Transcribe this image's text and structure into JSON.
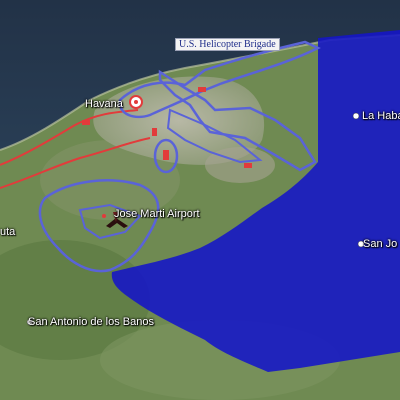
{
  "banner": {
    "text": "U.S. Helicopter Brigade"
  },
  "places": {
    "havana": "Havana",
    "la_habana": "La Haba",
    "jose_marti": "Jose Marti Airport",
    "san_jose": "San Jo",
    "left_edge": "uta",
    "san_antonio": "San Antonio de los Banos"
  },
  "colors": {
    "sea": "#2b3f56",
    "land": "#6f8a52",
    "urban": "#a9a69b",
    "operation_zone": "#1414c8",
    "route_outline": "#5a63d8",
    "red_route": "#e23b3b"
  },
  "icons": [
    "airport-icon",
    "city-dot-icon",
    "helicopter-target-icon"
  ]
}
